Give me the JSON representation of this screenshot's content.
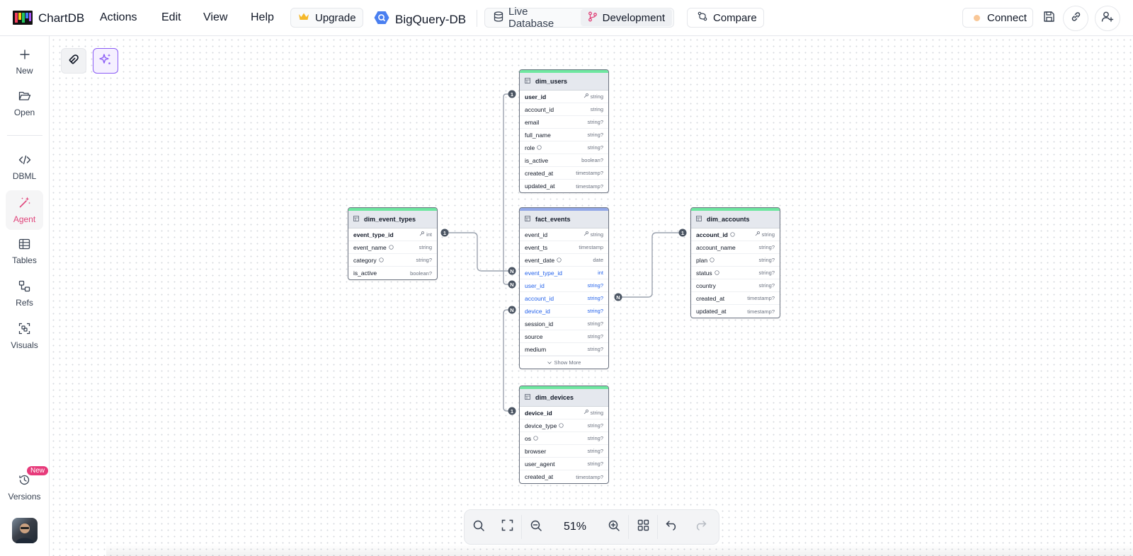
{
  "app": {
    "name": "ChartDB"
  },
  "menu": {
    "actions": "Actions",
    "edit": "Edit",
    "view": "View",
    "help": "Help"
  },
  "toolbar": {
    "upgrade": "Upgrade",
    "db_name": "BigQuery-DB",
    "env_live": "Live Database",
    "env_dev": "Development",
    "compare": "Compare",
    "connect": "Connect"
  },
  "sidebar": {
    "new": "New",
    "open": "Open",
    "dbml": "DBML",
    "agent": "Agent",
    "tables": "Tables",
    "refs": "Refs",
    "visuals": "Visuals",
    "versions": "Versions",
    "versions_badge": "New"
  },
  "zoom": {
    "level": "51%"
  },
  "colors": {
    "accent": "#e0457b",
    "fk": "#2563eb",
    "table_bar_green": "#6ee7a0",
    "table_bar_blue": "#93a8e8",
    "connect_dot": "#f9c797"
  },
  "tables": {
    "dim_users": {
      "name": "dim_users",
      "fields": [
        {
          "name": "user_id",
          "type": "string"
        },
        {
          "name": "account_id",
          "type": "string"
        },
        {
          "name": "email",
          "type": "string?"
        },
        {
          "name": "full_name",
          "type": "string?"
        },
        {
          "name": "role",
          "type": "string?"
        },
        {
          "name": "is_active",
          "type": "boolean?"
        },
        {
          "name": "created_at",
          "type": "timestamp?"
        },
        {
          "name": "updated_at",
          "type": "timestamp?"
        }
      ]
    },
    "dim_event_types": {
      "name": "dim_event_types",
      "fields": [
        {
          "name": "event_type_id",
          "type": "int"
        },
        {
          "name": "event_name",
          "type": "string"
        },
        {
          "name": "category",
          "type": "string?"
        },
        {
          "name": "is_active",
          "type": "boolean?"
        }
      ]
    },
    "fact_events": {
      "name": "fact_events",
      "show_more": "Show More",
      "fields": [
        {
          "name": "event_id",
          "type": "string"
        },
        {
          "name": "event_ts",
          "type": "timestamp"
        },
        {
          "name": "event_date",
          "type": "date"
        },
        {
          "name": "event_type_id",
          "type": "int"
        },
        {
          "name": "user_id",
          "type": "string?"
        },
        {
          "name": "account_id",
          "type": "string?"
        },
        {
          "name": "device_id",
          "type": "string?"
        },
        {
          "name": "session_id",
          "type": "string?"
        },
        {
          "name": "source",
          "type": "string?"
        },
        {
          "name": "medium",
          "type": "string?"
        }
      ]
    },
    "dim_accounts": {
      "name": "dim_accounts",
      "fields": [
        {
          "name": "account_id",
          "type": "string"
        },
        {
          "name": "account_name",
          "type": "string?"
        },
        {
          "name": "plan",
          "type": "string?"
        },
        {
          "name": "status",
          "type": "string?"
        },
        {
          "name": "country",
          "type": "string?"
        },
        {
          "name": "created_at",
          "type": "timestamp?"
        },
        {
          "name": "updated_at",
          "type": "timestamp?"
        }
      ]
    },
    "dim_devices": {
      "name": "dim_devices",
      "fields": [
        {
          "name": "device_id",
          "type": "string"
        },
        {
          "name": "device_type",
          "type": "string?"
        },
        {
          "name": "os",
          "type": "string?"
        },
        {
          "name": "browser",
          "type": "string?"
        },
        {
          "name": "user_agent",
          "type": "string?"
        },
        {
          "name": "created_at",
          "type": "timestamp?"
        }
      ]
    }
  },
  "relations": {
    "one": "1",
    "many": "N"
  }
}
